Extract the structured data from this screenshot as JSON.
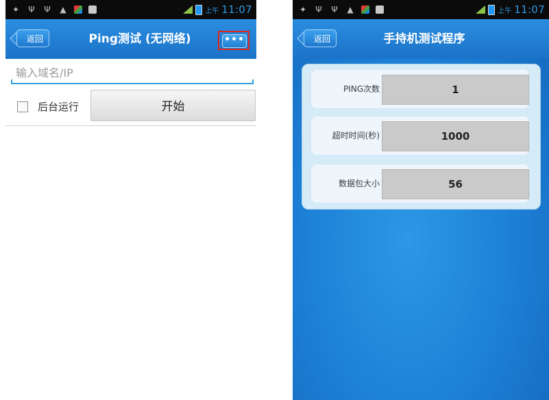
{
  "left_screen": {
    "status": {
      "ampm": "上午",
      "time": "11:07"
    },
    "title_bar": {
      "back_label": "返回",
      "title": "Ping测试 (无网络)",
      "more_label": "•••"
    },
    "host_input": {
      "placeholder": "输入域名/IP",
      "value": ""
    },
    "background_option": {
      "label": "后台运行",
      "checked": false
    },
    "start_button": {
      "label": "开始"
    }
  },
  "right_screen": {
    "status": {
      "ampm": "上午",
      "time": "11:07"
    },
    "title_bar": {
      "back_label": "返回",
      "title": "手持机测试程序"
    },
    "fields": [
      {
        "label": "PING次数",
        "value": "1"
      },
      {
        "label": "超时时间(秒)",
        "value": "1000"
      },
      {
        "label": "数据包大小",
        "value": "56"
      }
    ]
  },
  "colors": {
    "accent_blue": "#1f7fd5",
    "highlight_red": "#e3261a",
    "input_underline": "#2d9fe0"
  }
}
